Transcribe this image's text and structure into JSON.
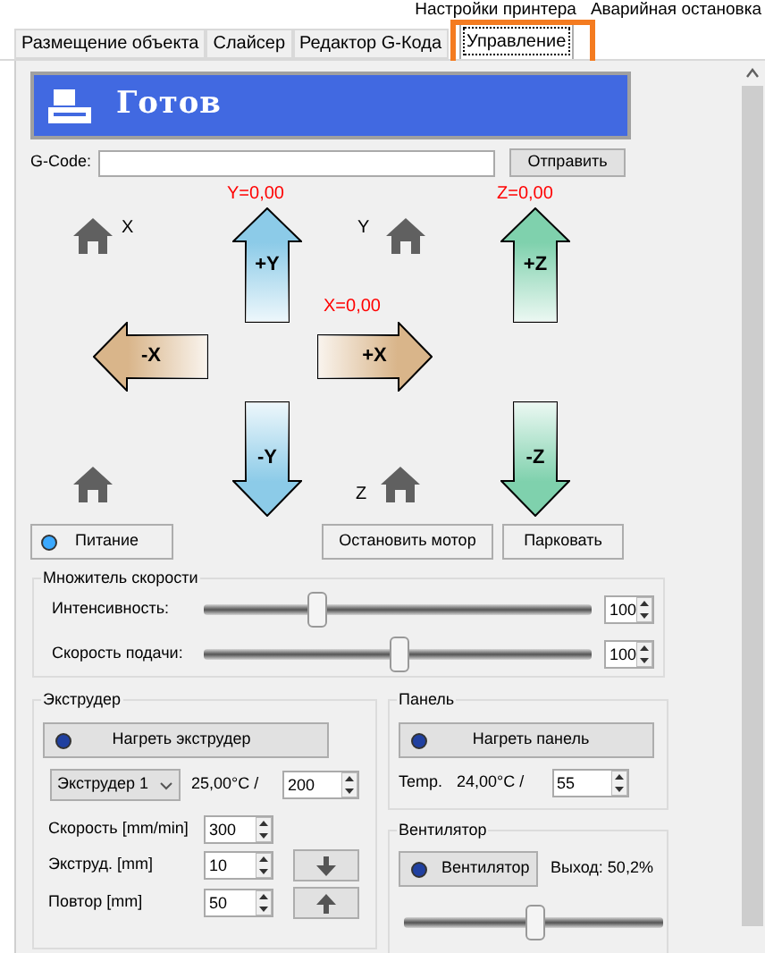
{
  "menu": [
    "Настройки принтера",
    "Аварийная остановка"
  ],
  "tabs": [
    {
      "label": "Размещение объекта",
      "selected": false
    },
    {
      "label": "Слайсер",
      "selected": false
    },
    {
      "label": "Редактор G-Кода",
      "selected": false
    },
    {
      "label": "Управление",
      "selected": true
    }
  ],
  "status": {
    "text": "Готов"
  },
  "gcode": {
    "label": "G-Code:",
    "button": "Отправить"
  },
  "jog": {
    "y_pos": "Y=0,00",
    "z_pos": "Z=0,00",
    "x_pos": "X=0,00",
    "home_x": "X",
    "home_y": "Y",
    "home_z": "Z",
    "arrows": [
      {
        "label": "+Y",
        "kind": "up",
        "color": "#8ccbe8"
      },
      {
        "label": "+Z",
        "kind": "up",
        "color": "#7fd1ad"
      },
      {
        "label": "-X",
        "kind": "left",
        "color": "#d9b58a"
      },
      {
        "label": "+X",
        "kind": "right",
        "color": "#d9b58a"
      },
      {
        "label": "-Y",
        "kind": "down",
        "color": "#8ccbe8"
      },
      {
        "label": "-Z",
        "kind": "down",
        "color": "#7fd1ad"
      }
    ]
  },
  "power": {
    "label": "Питание",
    "on": true
  },
  "buttons": [
    "Остановить мотор",
    "Парковать"
  ],
  "speed": {
    "title": "Множитель скорости",
    "rows": [
      {
        "label": "Интенсивность:",
        "level": 0.29,
        "value": "100"
      },
      {
        "label": "Скорость подачи:",
        "level": 0.5,
        "value": "100"
      }
    ]
  },
  "extruder": {
    "title": "Экструдер",
    "heat": "Нагреть экструдер",
    "select": "Экструдер 1",
    "temp": "25,00°C /",
    "target": "200",
    "rows": [
      {
        "label": "Скорость [mm/min]",
        "value": "300",
        "kind": "field"
      },
      {
        "label": "Экструд. [mm]",
        "value": "10",
        "kind": "down"
      },
      {
        "label": "Повтор [mm]",
        "value": "50",
        "kind": "up"
      }
    ]
  },
  "bed": {
    "title": "Панель",
    "heat": "Нагреть панель",
    "temp_label": "Temp.",
    "temp": "24,00°C /",
    "target": "55"
  },
  "fan": {
    "title": "Вентилятор",
    "button": "Вентилятор",
    "output": "Выход: 50,2%",
    "level": 0.5
  }
}
